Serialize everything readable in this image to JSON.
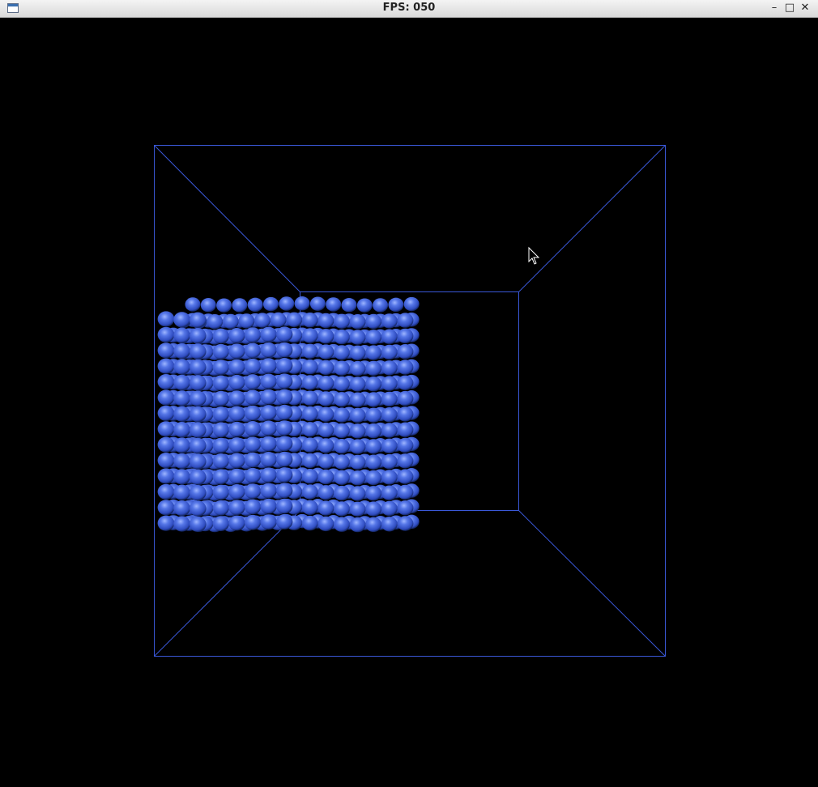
{
  "window": {
    "title": "FPS: 050",
    "controls": {
      "minimize": "–",
      "maximize": "□",
      "close": "✕"
    }
  },
  "scene": {
    "wire_color": "#3050d0",
    "particle_color": "#4a6ce0",
    "background": "#000000",
    "particle_columns": 16,
    "particle_rows": 15
  }
}
